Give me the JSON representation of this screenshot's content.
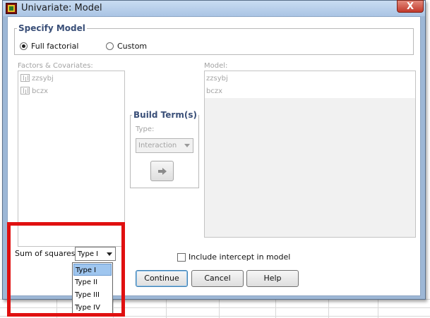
{
  "window": {
    "title": "Univariate: Model",
    "close_label": "X"
  },
  "specify_model": {
    "legend": "Specify Model",
    "options": [
      {
        "label": "Full factorial",
        "selected": true
      },
      {
        "label": "Custom",
        "selected": false
      }
    ]
  },
  "factors": {
    "label": "Factors & Covariates:",
    "items": [
      "zzsybj",
      "bczx"
    ]
  },
  "build_terms": {
    "legend": "Build Term(s)",
    "type_label": "Type:",
    "type_value": "Interaction",
    "move_icon": "right-arrow-icon"
  },
  "model": {
    "label": "Model:",
    "items": [
      "zzsybj",
      "bczx"
    ]
  },
  "sum_of_squares": {
    "label": "Sum of squares:",
    "selected": "Type I",
    "options": [
      "Type I",
      "Type II",
      "Type III",
      "Type IV"
    ]
  },
  "intercept": {
    "label": "Include intercept in model",
    "checked": false
  },
  "buttons": {
    "continue": "Continue",
    "cancel": "Cancel",
    "help": "Help"
  },
  "colors": {
    "highlight": "#e01010",
    "legend_text": "#3a4f78",
    "window_frame": "#9db7d6"
  }
}
